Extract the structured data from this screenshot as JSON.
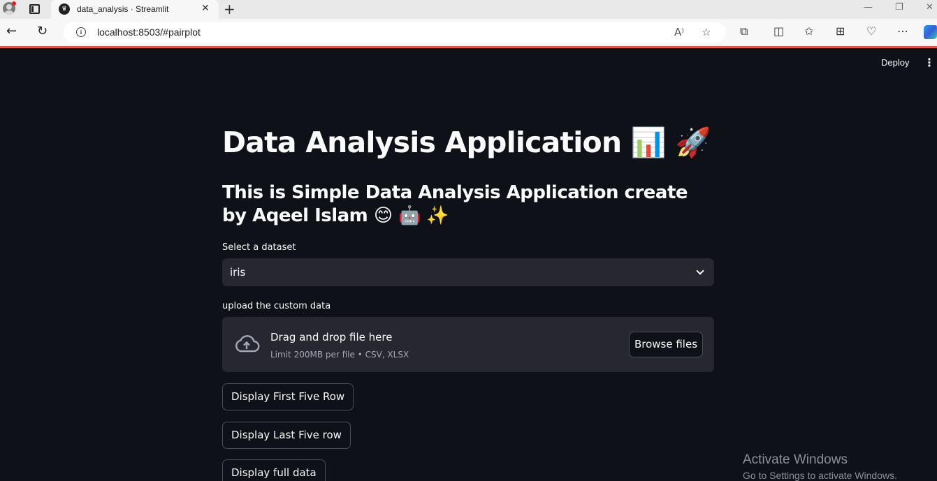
{
  "browser": {
    "tab_title": "data_analysis · Streamlit",
    "new_tab_icon": "plus-icon",
    "url": "localhost:8503/#pairplot",
    "read_aloud_label": "A⁾",
    "window_controls": [
      "minimize",
      "restore",
      "close"
    ]
  },
  "app": {
    "deploy_label": "Deploy",
    "title": "Data Analysis Application 📊 🚀",
    "subtitle": "This is Simple Data Analysis Application create by Aqeel Islam 😊 🤖 ✨",
    "dataset_select": {
      "label": "Select a dataset",
      "value": "iris"
    },
    "uploader": {
      "label": "upload the custom data",
      "drop_text": "Drag and drop file here",
      "limit_text": "Limit 200MB per file • CSV, XLSX",
      "browse_label": "Browse files"
    },
    "buttons": {
      "first_five": "Display First Five Row",
      "last_five": "Display Last Five row",
      "full_data": "Display full data"
    }
  },
  "watermark": {
    "line1": "Activate Windows",
    "line2": "Go to Settings to activate Windows."
  },
  "colors": {
    "background": "#0e1117",
    "widget_bg": "#262730",
    "text": "#fafafa",
    "accent_line": "#e2574c"
  }
}
